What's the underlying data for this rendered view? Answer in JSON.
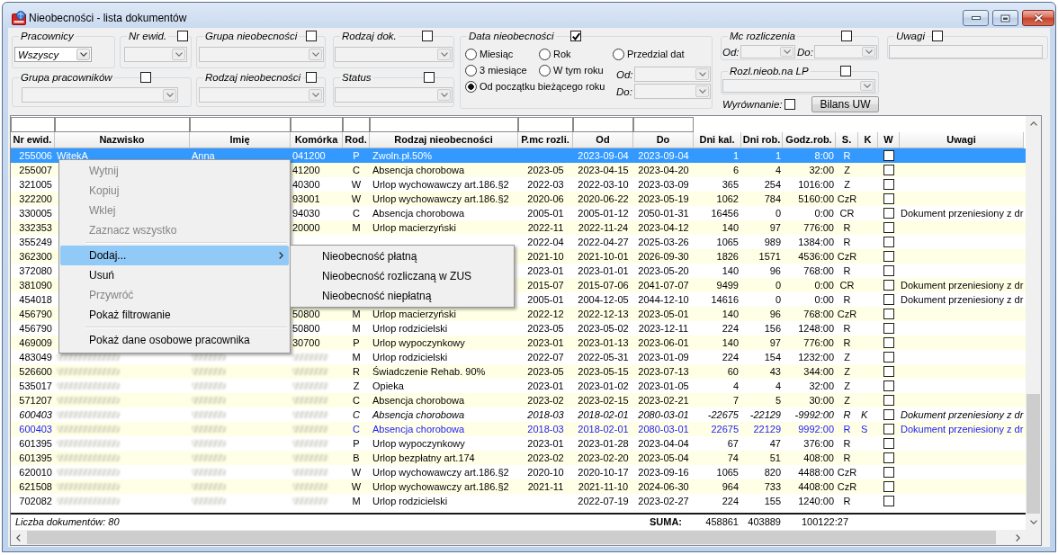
{
  "window": {
    "title": "Nieobecności - lista dokumentów"
  },
  "filters": {
    "pracownicy": {
      "label": "Pracownicy",
      "dropdown": {
        "value": "Wszyscy",
        "disabled": false
      }
    },
    "nr_ewid": {
      "label": "Nr ewid.",
      "checked": false,
      "dropdown": {
        "disabled": true
      }
    },
    "grupa_nieobecnosci": {
      "label": "Grupa nieobecności",
      "checked": false,
      "dropdown": {
        "disabled": true
      }
    },
    "rodzaj_dok": {
      "label": "Rodzaj dok.",
      "checked": false,
      "dropdown": {
        "disabled": true
      }
    },
    "data_nieobecnosci": {
      "label": "Data nieobecności",
      "checked": true,
      "options": [
        {
          "label": "Miesiąc",
          "selected": false
        },
        {
          "label": "Rok",
          "selected": false
        },
        {
          "label": "Przedzial dat",
          "selected": false
        },
        {
          "label": "3 miesiące",
          "selected": false
        },
        {
          "label": "W tym roku",
          "selected": false
        },
        {
          "label": "Od początku bieżącego roku",
          "selected": true
        }
      ],
      "od": {
        "label": "Od:",
        "disabled": true
      },
      "do": {
        "label": "Do:",
        "disabled": true
      }
    },
    "mc_rozliczenia": {
      "label": "Mc rozliczenia",
      "checked": false,
      "od": {
        "label": "Od:",
        "disabled": true
      },
      "do": {
        "label": "Do:",
        "disabled": true
      }
    },
    "uwagi": {
      "label": "Uwagi",
      "checked": false,
      "field": {
        "disabled": true
      }
    },
    "grupa_pracownikow": {
      "label": "Grupa pracowników",
      "checked": false,
      "dropdown": {
        "disabled": true
      }
    },
    "rodzaj_nieobecnosci": {
      "label": "Rodzaj nieobecności",
      "checked": false,
      "dropdown": {
        "disabled": true
      }
    },
    "status": {
      "label": "Status",
      "checked": false,
      "dropdown": {
        "disabled": true
      }
    },
    "rozl_nieob_na_lp": {
      "label": "Rozl.nieob.na LP",
      "checked": false,
      "dropdown": {
        "disabled": true
      }
    },
    "wyrownanie": {
      "label": "Wyrównanie:",
      "checked": false
    },
    "bilans_uw": {
      "label": "Bilans UW"
    }
  },
  "table": {
    "columns": [
      {
        "label": "Nr ewid.",
        "filter": true
      },
      {
        "label": "Nazwisko",
        "filter": true
      },
      {
        "label": "Imię",
        "filter": true
      },
      {
        "label": "Komórka",
        "filter": true
      },
      {
        "label": "Rod.",
        "filter": true
      },
      {
        "label": "Rodzaj nieobecności",
        "filter": true
      },
      {
        "label": "P.mc rozli.",
        "filter": true
      },
      {
        "label": "Od",
        "filter": true
      },
      {
        "label": "Do",
        "filter": true
      },
      {
        "label": "Dni kal.",
        "filter": false
      },
      {
        "label": "Dni rob.",
        "filter": false
      },
      {
        "label": "Godz.rob.",
        "filter": false
      },
      {
        "label": "S.",
        "filter": false
      },
      {
        "label": "K",
        "filter": false
      },
      {
        "label": "W",
        "filter": false
      },
      {
        "label": "Uwagi",
        "filter": false
      }
    ],
    "rows": [
      {
        "nr_ewid": "255006",
        "nazwisko": "WitekA",
        "imie": "Anna",
        "komorka": "041200",
        "rod": "P",
        "rodzaj": "Zwoln.pł.50%",
        "od": "2023-09-04",
        "do": "2023-09-04",
        "dni_kal": "1",
        "dni_rob": "1",
        "godz_rob": "8:00",
        "s": "R",
        "w_checked": false,
        "kind": "plain",
        "blurred": false,
        "selected": true
      },
      {
        "nr_ewid": "255007",
        "komorka": "41200",
        "rod": "C",
        "rodzaj": "Absencja chorobowa",
        "pmc": "2023-05",
        "od": "2023-04-15",
        "do": "2023-04-20",
        "dni_kal": "6",
        "dni_rob": "4",
        "godz_rob": "32:00",
        "s": "Z",
        "w_checked": false,
        "kind": "plain",
        "blurred": false,
        "selected": false
      },
      {
        "nr_ewid": "321005",
        "komorka": "40300",
        "rod": "W",
        "rodzaj": "Urlop wychowawczy art.186.§2",
        "pmc": "2022-03",
        "od": "2022-03-10",
        "do": "2023-03-09",
        "dni_kal": "365",
        "dni_rob": "254",
        "godz_rob": "1016:00",
        "s": "Z",
        "w_checked": false,
        "kind": "plain",
        "blurred": false,
        "selected": false
      },
      {
        "nr_ewid": "322200",
        "komorka": "93001",
        "rod": "W",
        "rodzaj": "Urlop wychowawczy art.186.§2",
        "pmc": "2020-06",
        "od": "2020-06-22",
        "do": "2023-05-19",
        "dni_kal": "1062",
        "dni_rob": "784",
        "godz_rob": "5160:00",
        "s": "CzR",
        "w_checked": false,
        "kind": "plain",
        "blurred": false,
        "selected": false
      },
      {
        "nr_ewid": "330005",
        "komorka": "94030",
        "rod": "C",
        "rodzaj": "Absencja chorobowa",
        "pmc": "2005-01",
        "od": "2005-01-12",
        "do": "2050-01-31",
        "dni_kal": "16456",
        "dni_rob": "0",
        "godz_rob": "0:00",
        "s": "CR",
        "w_checked": false,
        "uwagi": "Dokument przeniesiony z dr",
        "kind": "plain",
        "blurred": false,
        "selected": false
      },
      {
        "nr_ewid": "332353",
        "komorka": "20000",
        "rod": "M",
        "rodzaj": "Urlop macierzyński",
        "pmc": "2022-11",
        "od": "2022-11-24",
        "do": "2023-04-12",
        "dni_kal": "140",
        "dni_rob": "97",
        "godz_rob": "776:00",
        "s": "R",
        "w_checked": false,
        "kind": "plain",
        "blurred": false,
        "selected": false
      },
      {
        "nr_ewid": "355249",
        "pmc": "2022-04",
        "od": "2022-04-27",
        "do": "2025-03-26",
        "dni_kal": "1065",
        "dni_rob": "989",
        "godz_rob": "1384:00",
        "s": "R",
        "w_checked": false,
        "kind": "plain",
        "blurred": false,
        "selected": false
      },
      {
        "nr_ewid": "362300",
        "pmc": "2021-10",
        "od": "2021-10-01",
        "do": "2026-09-30",
        "dni_kal": "1826",
        "dni_rob": "1571",
        "godz_rob": "4536:00",
        "s": "CzR",
        "w_checked": false,
        "kind": "plain",
        "blurred": false,
        "selected": false
      },
      {
        "nr_ewid": "372080",
        "pmc": "2023-01",
        "od": "2023-01-01",
        "do": "2023-05-20",
        "dni_kal": "140",
        "dni_rob": "96",
        "godz_rob": "768:00",
        "s": "R",
        "w_checked": false,
        "kind": "plain",
        "blurred": false,
        "selected": false
      },
      {
        "nr_ewid": "381090",
        "pmc": "2015-07",
        "od": "2015-07-06",
        "do": "2041-07-07",
        "dni_kal": "9499",
        "dni_rob": "0",
        "godz_rob": "0:00",
        "s": "CR",
        "w_checked": false,
        "uwagi": "Dokument przeniesiony z dr",
        "kind": "plain",
        "blurred": false,
        "selected": false
      },
      {
        "nr_ewid": "454018",
        "pmc": "2005-01",
        "od": "2004-12-05",
        "do": "2044-12-10",
        "dni_kal": "14616",
        "dni_rob": "0",
        "godz_rob": "0:00",
        "s": "R",
        "w_checked": false,
        "uwagi": "Dokument przeniesiony z dr",
        "kind": "plain",
        "blurred": false,
        "selected": false
      },
      {
        "nr_ewid": "456790",
        "komorka": "50800",
        "rod": "M",
        "rodzaj": "Urlop macierzyński",
        "pmc": "2022-12",
        "od": "2022-12-13",
        "do": "2023-05-01",
        "dni_kal": "140",
        "dni_rob": "96",
        "godz_rob": "768:00",
        "s": "CzR",
        "w_checked": false,
        "kind": "plain",
        "blurred": false,
        "selected": false
      },
      {
        "nr_ewid": "456790",
        "komorka": "50800",
        "rod": "M",
        "rodzaj": "Urlop rodzicielski",
        "pmc": "2023-05",
        "od": "2023-05-02",
        "do": "2023-12-11",
        "dni_kal": "224",
        "dni_rob": "156",
        "godz_rob": "1248:00",
        "s": "R",
        "w_checked": false,
        "kind": "plain",
        "blurred": false,
        "selected": false
      },
      {
        "nr_ewid": "469009",
        "komorka": "30700",
        "rod": "P",
        "rodzaj": "Urlop wypoczynkowy",
        "pmc": "2023-01",
        "od": "2023-01-13",
        "do": "2023-06-01",
        "dni_kal": "140",
        "dni_rob": "97",
        "godz_rob": "776:00",
        "s": "R",
        "w_checked": false,
        "kind": "plain",
        "blurred": false,
        "selected": false
      },
      {
        "nr_ewid": "483049",
        "rod": "M",
        "rodzaj": "Urlop rodzicielski",
        "pmc": "2022-07",
        "od": "2022-05-31",
        "do": "2023-01-09",
        "dni_kal": "224",
        "dni_rob": "154",
        "godz_rob": "1232:00",
        "s": "Z",
        "w_checked": false,
        "kind": "plain",
        "blurred": true,
        "selected": false
      },
      {
        "nr_ewid": "526600",
        "rod": "R",
        "rodzaj": "Świadczenie Rehab. 90%",
        "pmc": "2023-05",
        "od": "2023-05-15",
        "do": "2023-07-13",
        "dni_kal": "60",
        "dni_rob": "43",
        "godz_rob": "344:00",
        "s": "Z",
        "w_checked": false,
        "kind": "plain",
        "blurred": true,
        "selected": false
      },
      {
        "nr_ewid": "535017",
        "rod": "Z",
        "rodzaj": "Opieka",
        "pmc": "2023-01",
        "od": "2023-01-02",
        "do": "2023-01-05",
        "dni_kal": "4",
        "dni_rob": "4",
        "godz_rob": "32:00",
        "s": "Z",
        "w_checked": false,
        "kind": "plain",
        "blurred": true,
        "selected": false
      },
      {
        "nr_ewid": "571207",
        "rod": "C",
        "rodzaj": "Absencja chorobowa",
        "pmc": "2023-02",
        "od": "2023-02-15",
        "do": "2023-02-21",
        "dni_kal": "7",
        "dni_rob": "5",
        "godz_rob": "30:00",
        "s": "Z",
        "w_checked": false,
        "kind": "plain",
        "blurred": true,
        "selected": false
      },
      {
        "nr_ewid": "600403",
        "rod": "C",
        "rodzaj": "Absencja chorobowa",
        "pmc": "2018-03",
        "od": "2018-02-01",
        "do": "2080-03-01",
        "dni_kal": "-22675",
        "dni_rob": "-22129",
        "godz_rob": "-9992:00",
        "s": "R",
        "k": "K",
        "w_checked": false,
        "uwagi": "Dokument przeniesiony z dr",
        "kind": "italic",
        "blurred": true,
        "selected": false
      },
      {
        "nr_ewid": "600403",
        "rod": "C",
        "rodzaj": "Absencja chorobowa",
        "pmc": "2018-03",
        "od": "2018-02-01",
        "do": "2080-03-01",
        "dni_kal": "22675",
        "dni_rob": "22129",
        "godz_rob": "9992:00",
        "s": "R",
        "k": "S",
        "w_checked": false,
        "uwagi": "Dokument przeniesiony z dr",
        "kind": "blue",
        "blurred": true,
        "selected": false
      },
      {
        "nr_ewid": "601395",
        "rod": "P",
        "rodzaj": "Urlop wypoczynkowy",
        "pmc": "2023-01",
        "od": "2023-01-28",
        "do": "2023-04-04",
        "dni_kal": "67",
        "dni_rob": "47",
        "godz_rob": "376:00",
        "s": "R",
        "w_checked": false,
        "kind": "plain",
        "blurred": true,
        "selected": false
      },
      {
        "nr_ewid": "601395",
        "rod": "B",
        "rodzaj": "Urlop bezpłatny art.174",
        "pmc": "2023-02",
        "od": "2023-02-20",
        "do": "2023-05-04",
        "dni_kal": "74",
        "dni_rob": "51",
        "godz_rob": "408:00",
        "s": "R",
        "w_checked": false,
        "kind": "plain",
        "blurred": true,
        "selected": false
      },
      {
        "nr_ewid": "620010",
        "rod": "W",
        "rodzaj": "Urlop wychowawczy art.186.§2",
        "pmc": "2020-10",
        "od": "2020-10-17",
        "do": "2023-09-16",
        "dni_kal": "1065",
        "dni_rob": "820",
        "godz_rob": "4488:00",
        "s": "CzR",
        "w_checked": false,
        "kind": "plain",
        "blurred": true,
        "selected": false
      },
      {
        "nr_ewid": "621508",
        "rod": "W",
        "rodzaj": "Urlop wychowawczy art.186.§2",
        "pmc": "2021-11",
        "od": "2021-11-10",
        "do": "2024-06-30",
        "dni_kal": "964",
        "dni_rob": "733",
        "godz_rob": "4408:00",
        "s": "CzR",
        "w_checked": false,
        "kind": "plain",
        "blurred": true,
        "selected": false
      },
      {
        "nr_ewid": "702082",
        "rod": "M",
        "rodzaj": "Urlop rodzicielski",
        "od": "2022-07-19",
        "do": "2023-02-27",
        "dni_kal": "224",
        "dni_rob": "155",
        "godz_rob": "1240:00",
        "s": "R",
        "w_checked": false,
        "kind": "plain",
        "blurred": true,
        "selected": false
      }
    ],
    "footer": {
      "count": "Liczba dokumentów: 80",
      "sum_label": "SUMA:",
      "sums": [
        "458861",
        "403889",
        "100122:27"
      ]
    }
  },
  "context_menu": {
    "items": [
      {
        "kind": "item",
        "label": "Wytnij",
        "disabled": true,
        "selected": false,
        "submenu": false
      },
      {
        "kind": "item",
        "label": "Kopiuj",
        "disabled": true,
        "selected": false,
        "submenu": false
      },
      {
        "kind": "item",
        "label": "Wklej",
        "disabled": true,
        "selected": false,
        "submenu": false
      },
      {
        "kind": "item",
        "label": "Zaznacz wszystko",
        "disabled": true,
        "selected": false,
        "submenu": false
      },
      {
        "kind": "separator"
      },
      {
        "kind": "item",
        "label": "Dodaj...",
        "disabled": false,
        "selected": true,
        "submenu": true
      },
      {
        "kind": "item",
        "label": "Usuń",
        "disabled": false,
        "selected": false,
        "submenu": false
      },
      {
        "kind": "item",
        "label": "Przywróć",
        "disabled": true,
        "selected": false,
        "submenu": false
      },
      {
        "kind": "item",
        "label": "Pokaż filtrowanie",
        "disabled": false,
        "selected": false,
        "submenu": false
      },
      {
        "kind": "separator"
      },
      {
        "kind": "item",
        "label": "Pokaż dane osobowe pracownika",
        "disabled": false,
        "selected": false,
        "submenu": false
      }
    ],
    "submenu": {
      "items": [
        {
          "label": "Nieobecność płatną",
          "selected": false
        },
        {
          "label": "Nieobecność rozliczaną w ZUS",
          "selected": false
        },
        {
          "label": "Nieobecność niepłatną",
          "selected": false
        }
      ]
    }
  }
}
